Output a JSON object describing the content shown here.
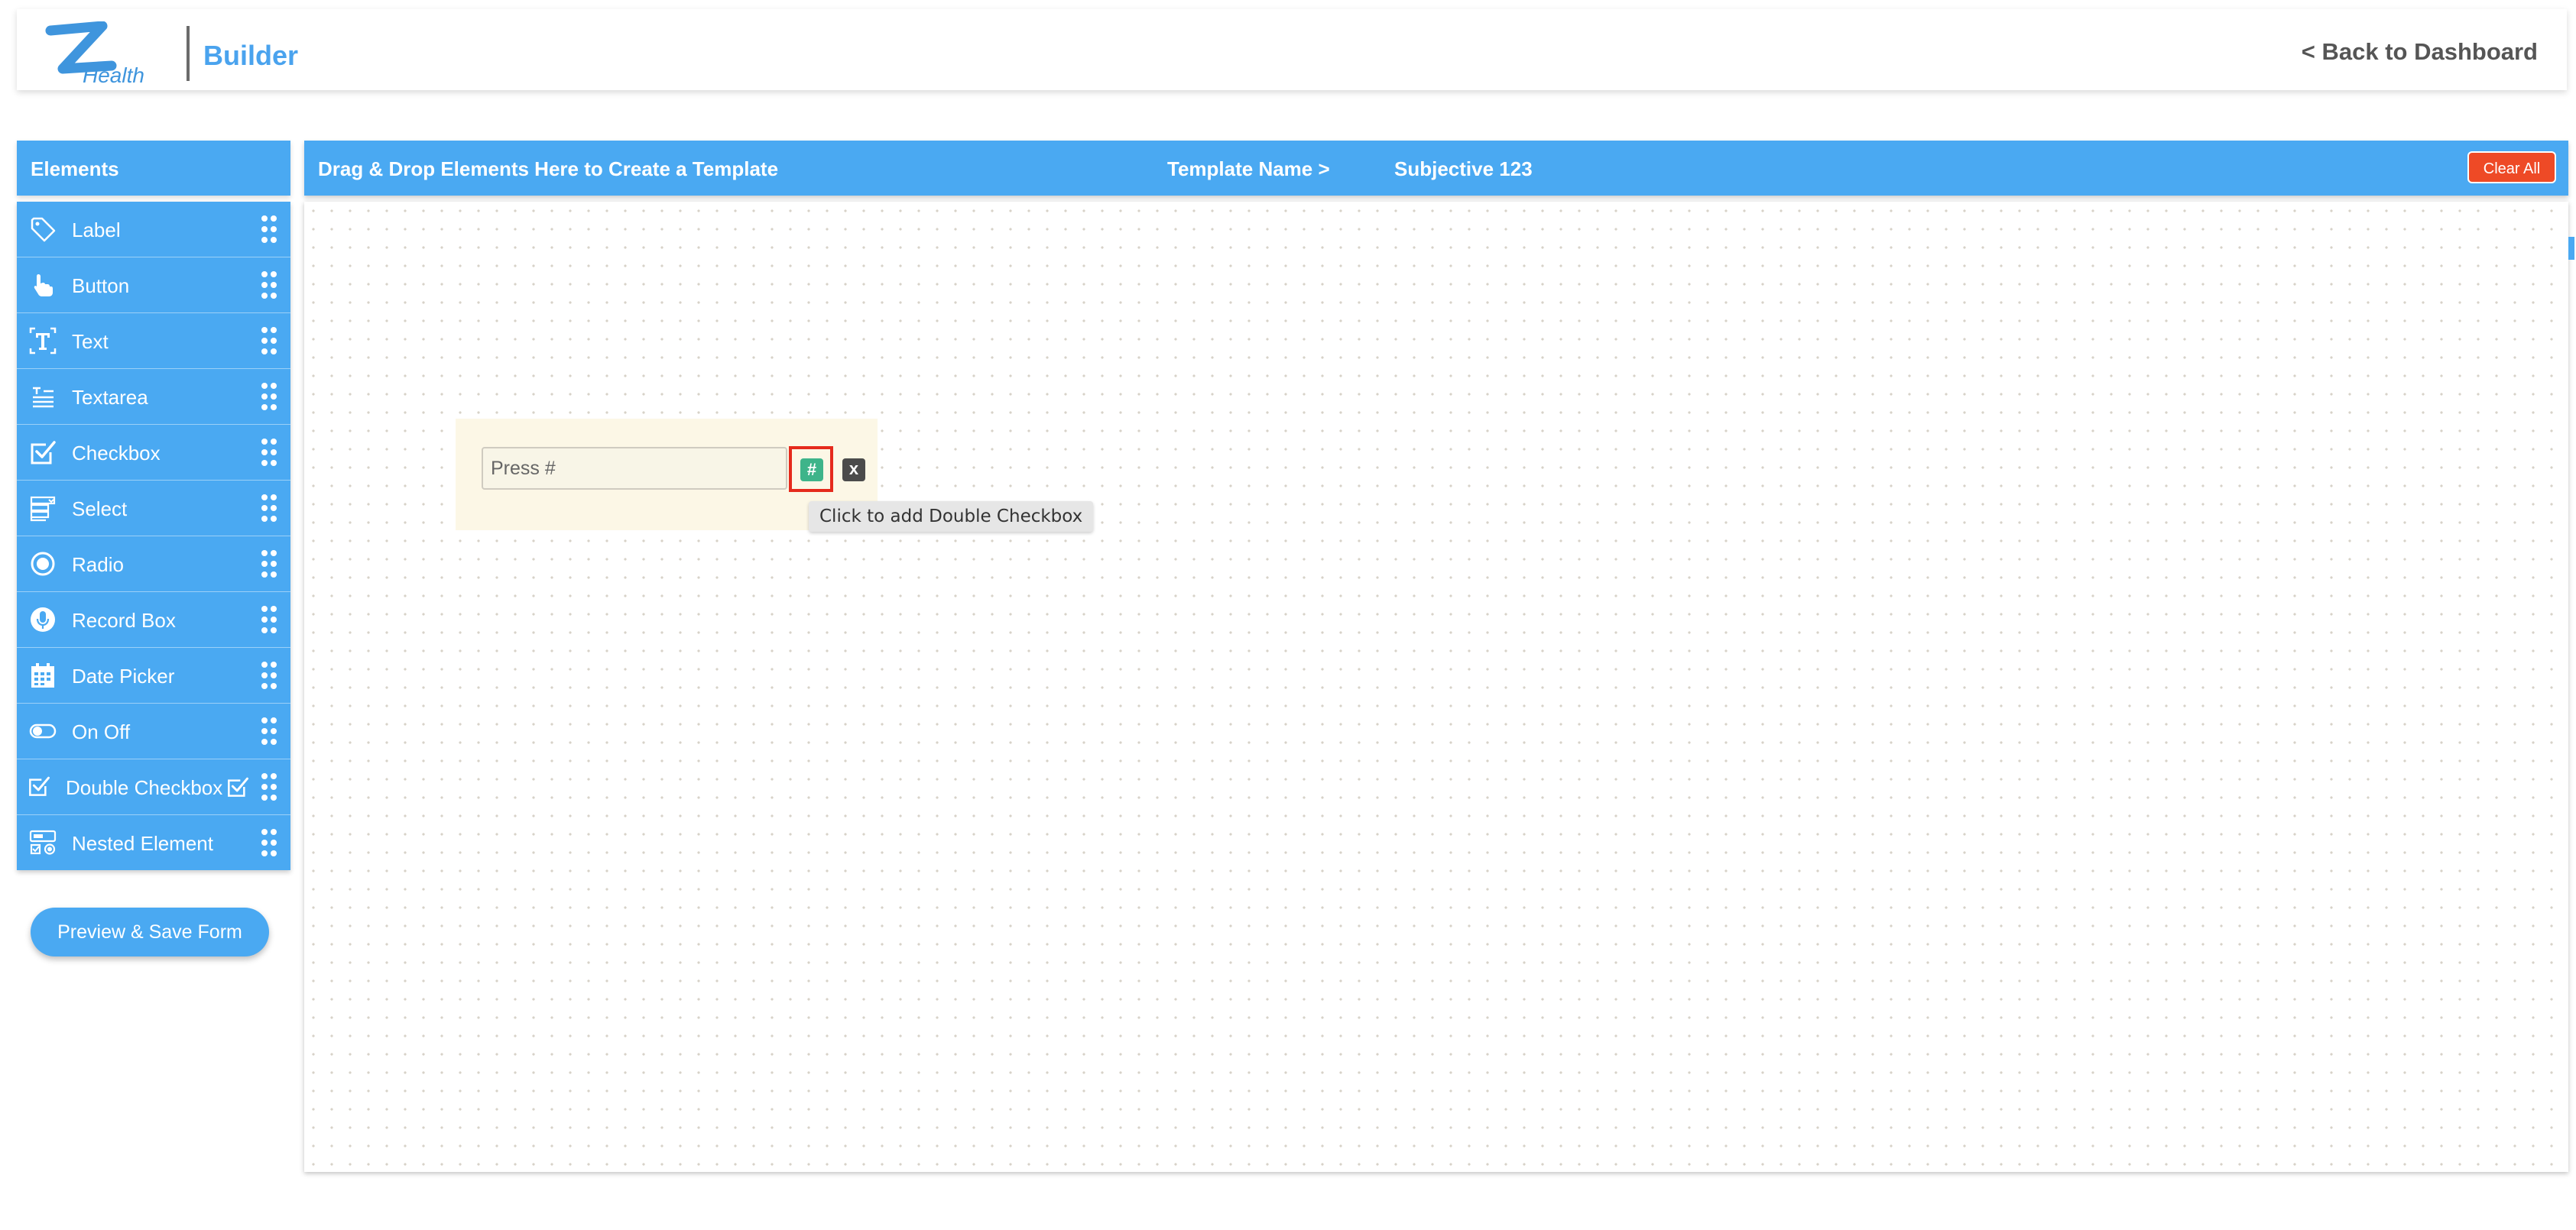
{
  "header": {
    "logo_text": "Health",
    "app_title": "Builder",
    "back_link": "< Back to Dashboard"
  },
  "sidebar": {
    "title": "Elements",
    "items": [
      {
        "label": "Label",
        "icon": "tag-icon"
      },
      {
        "label": "Button",
        "icon": "pointer-hand-icon"
      },
      {
        "label": "Text",
        "icon": "text-icon"
      },
      {
        "label": "Textarea",
        "icon": "textarea-icon"
      },
      {
        "label": "Checkbox",
        "icon": "checkbox-icon"
      },
      {
        "label": "Select",
        "icon": "select-icon"
      },
      {
        "label": "Radio",
        "icon": "radio-icon"
      },
      {
        "label": "Record Box",
        "icon": "microphone-icon"
      },
      {
        "label": "Date Picker",
        "icon": "calendar-icon"
      },
      {
        "label": "On Off",
        "icon": "toggle-icon"
      },
      {
        "label": "Double Checkbox",
        "icon": "checkbox-icon"
      },
      {
        "label": "Nested Element",
        "icon": "nested-element-icon"
      }
    ],
    "preview_button": "Preview & Save Form"
  },
  "main": {
    "drop_hint": "Drag & Drop Elements Here to Create a Template",
    "template_name_label": "Template Name >",
    "template_name": "Subjective 123",
    "clear_button": "Clear All"
  },
  "canvas": {
    "input_placeholder": "Press #",
    "hash_button": "#",
    "remove_button": "x",
    "tooltip": "Click to add Double Checkbox"
  },
  "colors": {
    "accent": "#4aa9f2",
    "clear": "#ee4a26",
    "hash_button": "#3eb48a",
    "highlight": "#e52a1c"
  }
}
